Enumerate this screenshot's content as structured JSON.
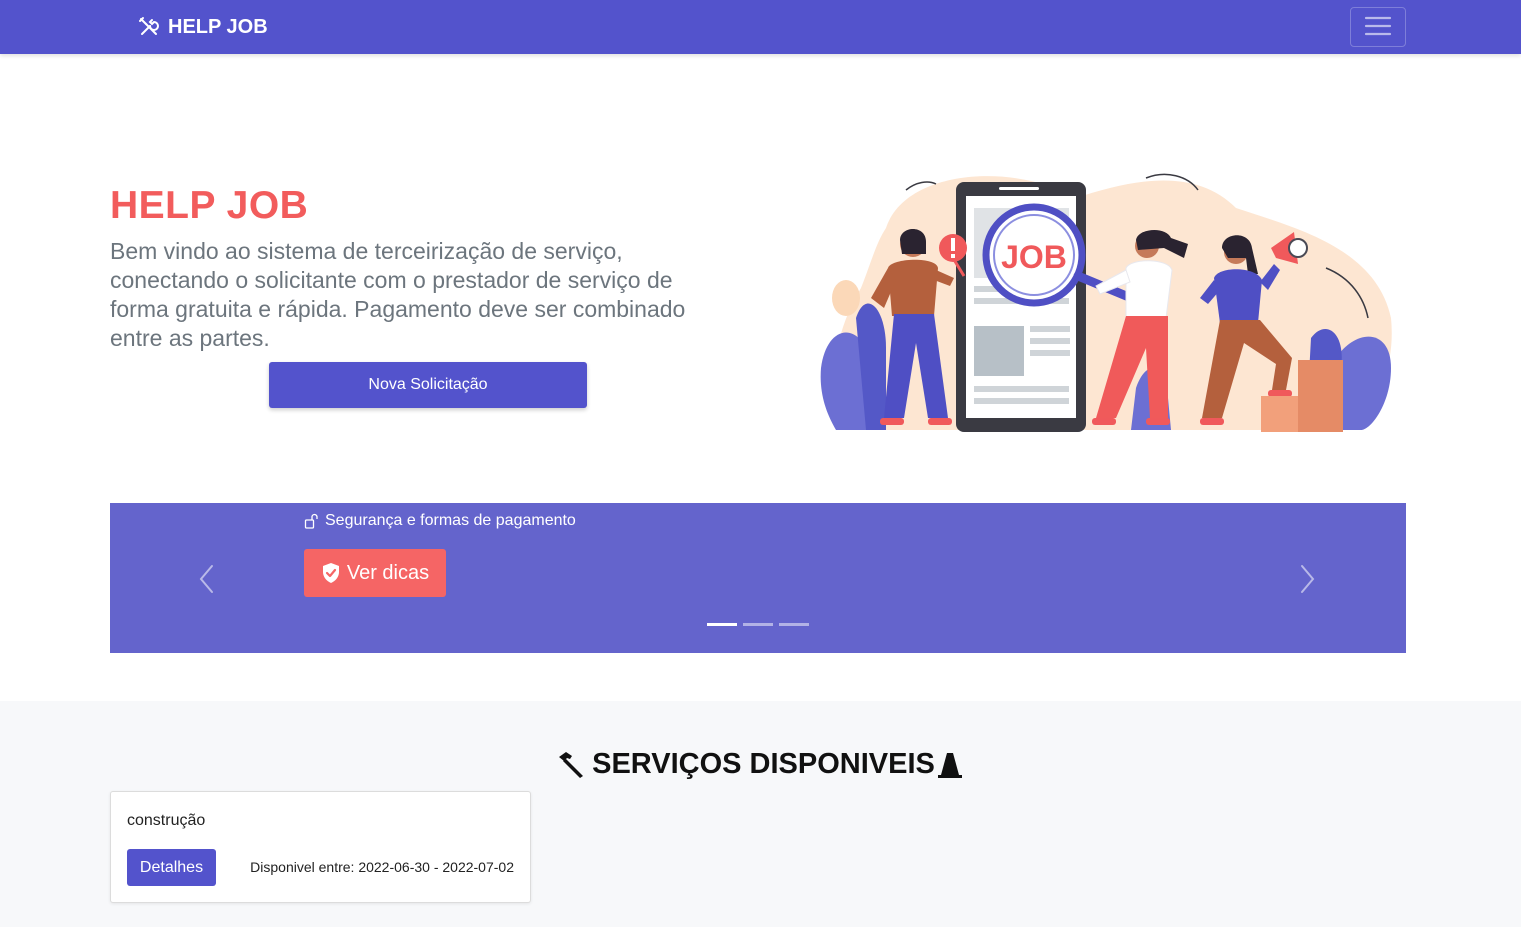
{
  "navbar": {
    "brand": "HELP JOB",
    "brand_icon": "tools-icon",
    "toggler_icon": "hamburger-menu-icon"
  },
  "hero": {
    "title": "HELP JOB",
    "description": "Bem vindo ao sistema de terceirização de serviço, conectando o solicitante com o prestador de serviço de forma gratuita e rápida. Pagamento deve ser combinado entre as partes.",
    "button_label": "Nova Solicitação",
    "illustration_text": "JOB"
  },
  "carousel": {
    "caption": "Segurança e formas de pagamento",
    "caption_icon": "unlock-icon",
    "button_label": "Ver dicas",
    "button_icon": "shield-check-icon",
    "slide_count": 3,
    "active_slide": 1
  },
  "services": {
    "title": "SERVIÇOS DISPONIVEIS",
    "leading_icon": "hammer-icon",
    "trailing_icon": "traffic-cone-icon",
    "items": [
      {
        "name": "construção",
        "button_label": "Detalhes",
        "availability": "Disponivel entre: 2022-06-30 - 2022-07-02"
      }
    ]
  },
  "colors": {
    "primary": "#5353cc",
    "carousel_bg": "#6464cc",
    "accent_red": "#f25c5c",
    "services_bg": "#f7f8fa"
  }
}
